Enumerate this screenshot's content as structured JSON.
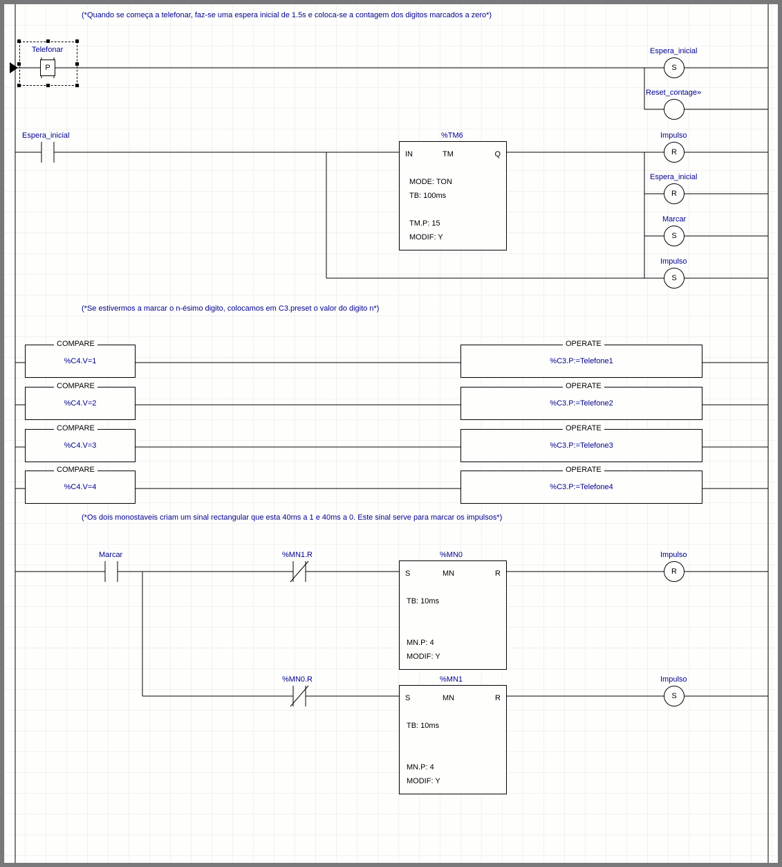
{
  "comments": {
    "c1": "(*Quando se começa a telefonar, faz-se uma espera inicial de 1.5s e coloca-se a contagem dos digitos marcados a zero*)",
    "c2": "(*Se estivermos a marcar o n-ésimo digito, colocamos em C3.preset o valor do digito n*)",
    "c3": "(*Os dois monostaveis criam um sinal rectangular que esta 40ms a 1 e 40ms a 0. Este sinal serve para marcar os impulsos*)"
  },
  "rung1": {
    "contact_label": "Telefonar",
    "contact_mod": "P",
    "coil1_label": "Espera_inicial",
    "coil1_letter": "S",
    "coil2_label": "Reset_contage»",
    "coil2_letter": ""
  },
  "rung2": {
    "contact_label": "Espera_inicial",
    "timer_name": "%TM6",
    "timer_in": "IN",
    "timer_type": "TM",
    "timer_q": "Q",
    "timer_mode": "MODE: TON",
    "timer_tb": "TB:  100ms",
    "timer_tmp": "TM.P: 15",
    "timer_modif": "MODIF: Y",
    "coilA_label": "Impulso",
    "coilA_letter": "R",
    "coilB_label": "Espera_inicial",
    "coilB_letter": "R",
    "coilC_label": "Marcar",
    "coilC_letter": "S",
    "coilD_label": "Impulso",
    "coilD_letter": "S"
  },
  "rung3": {
    "compare_title": "COMPARE",
    "operate_title": "OPERATE",
    "rows": [
      {
        "cmp": "%C4.V=1",
        "op": "%C3.P:=Telefone1"
      },
      {
        "cmp": "%C4.V=2",
        "op": "%C3.P:=Telefone2"
      },
      {
        "cmp": "%C4.V=3",
        "op": "%C3.P:=Telefone3"
      },
      {
        "cmp": "%C4.V=4",
        "op": "%C3.P:=Telefone4"
      }
    ]
  },
  "rung4": {
    "contact_label": "Marcar",
    "nc1_label": "%MN1.R",
    "nc2_label": "%MN0.R",
    "mnA_name": "%MN0",
    "mnB_name": "%MN1",
    "mn_S": "S",
    "mn_MN": "MN",
    "mn_R": "R",
    "mn_tb": "TB:  10ms",
    "mn_mnp": "MN.P: 4",
    "mn_modif": "MODIF: Y",
    "coilA_label": "Impulso",
    "coilA_letter": "R",
    "coilB_label": "Impulso",
    "coilB_letter": "S"
  }
}
